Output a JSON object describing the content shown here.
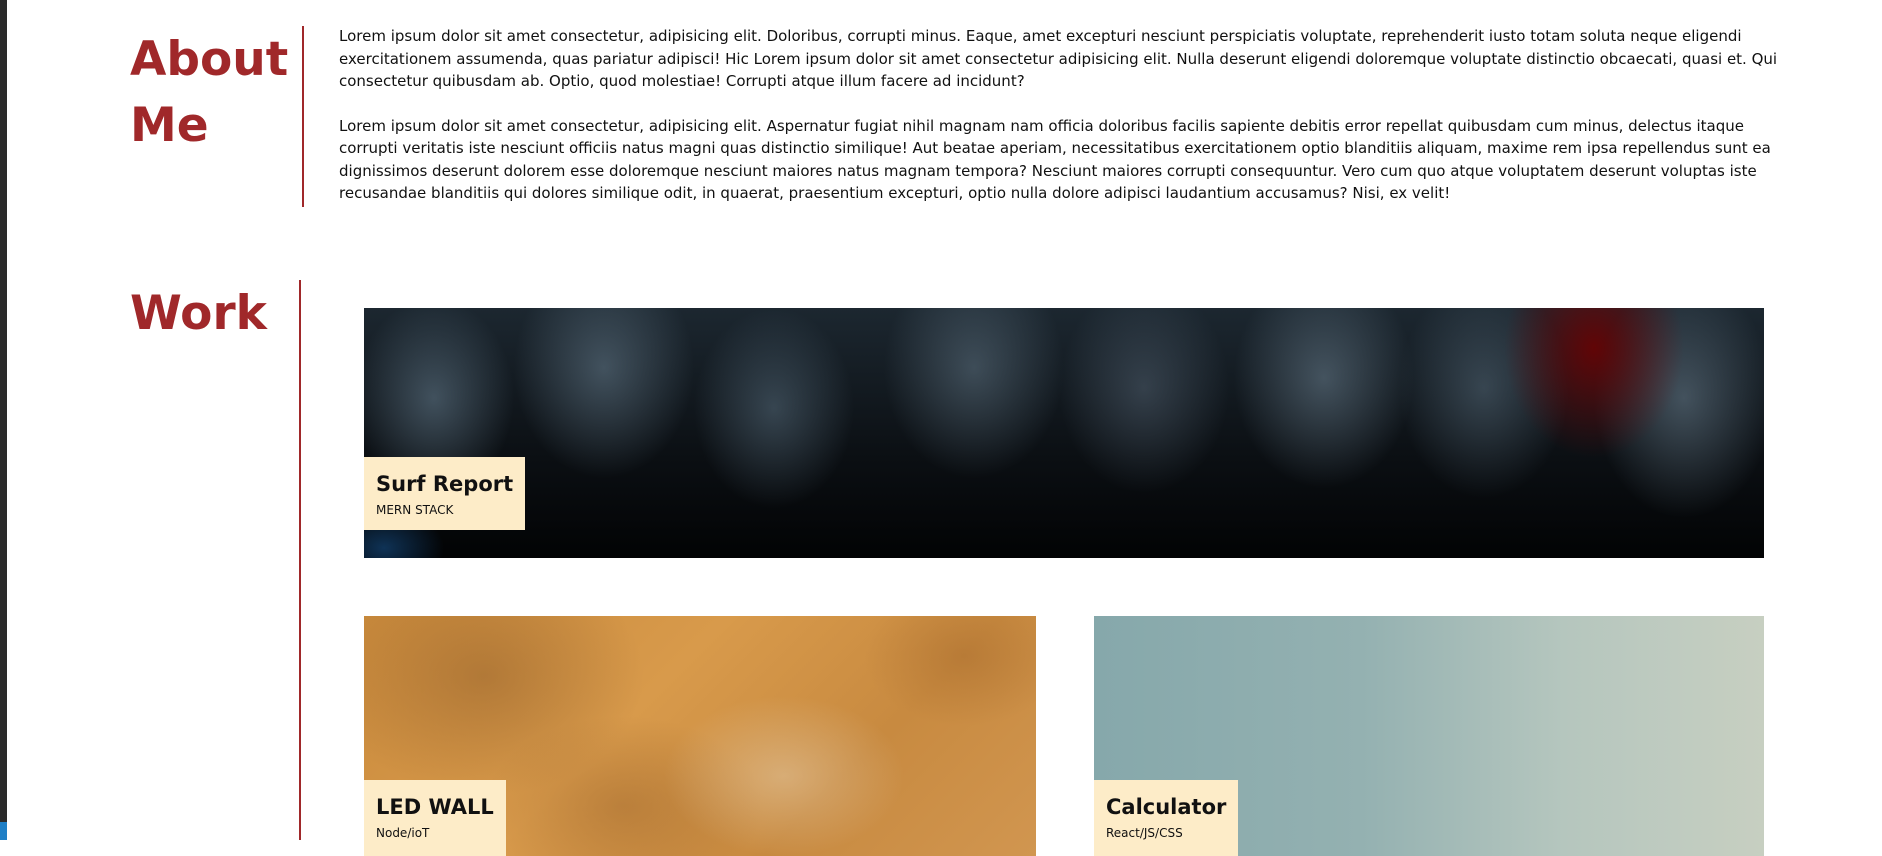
{
  "about": {
    "heading": "About Me",
    "paragraphs": [
      "Lorem ipsum dolor sit amet consectetur, adipisicing elit. Doloribus, corrupti minus. Eaque, amet excepturi nesciunt perspiciatis voluptate, reprehenderit iusto totam soluta neque eligendi exercitationem assumenda, quas pariatur adipisci! Hic Lorem ipsum dolor sit amet consectetur adipisicing elit. Nulla deserunt eligendi doloremque voluptate distinctio obcaecati, quasi et. Qui consectetur quibusdam ab. Optio, quod molestiae! Corrupti atque illum facere ad incidunt?",
      "Lorem ipsum dolor sit amet consectetur, adipisicing elit. Aspernatur fugiat nihil magnam nam officia doloribus facilis sapiente debitis error repellat quibusdam cum minus, delectus itaque corrupti veritatis iste nesciunt officiis natus magni quas distinctio similique! Aut beatae aperiam, necessitatibus exercitationem optio blanditiis aliquam, maxime rem ipsa repellendus sunt ea dignissimos deserunt dolorem esse doloremque nesciunt maiores natus magnam tempora? Nesciunt maiores corrupti consequuntur. Vero cum quo atque voluptatem deserunt voluptas iste recusandae blanditiis qui dolores similique odit, in quaerat, praesentium excepturi, optio nulla dolore adipisci laudantium accusamus? Nisi, ex velit!"
    ]
  },
  "work": {
    "heading": "Work",
    "projects": [
      {
        "title": "Surf Report",
        "stack": "MERN STACK"
      },
      {
        "title": "LED WALL",
        "stack": "Node/ioT"
      },
      {
        "title": "Calculator",
        "stack": "React/JS/CSS"
      }
    ]
  },
  "colors": {
    "accent": "#a0282a",
    "label_background": "#fdecc8",
    "text": "#111111"
  }
}
